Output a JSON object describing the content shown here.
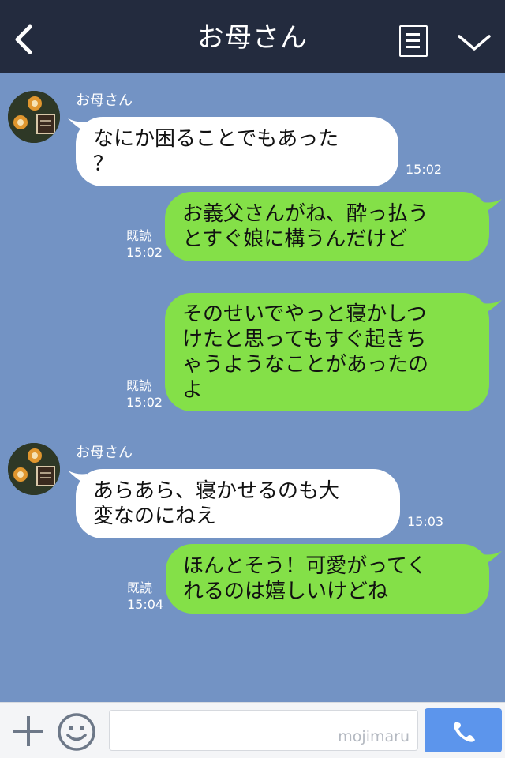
{
  "header": {
    "title": "お母さん",
    "back_icon": "chevron-left-icon",
    "menu_icon": "menu-icon",
    "more_icon": "chevron-down-icon"
  },
  "messages": [
    {
      "direction": "in",
      "sender": "お母さん",
      "text": "なにか困ることでもあった\n？",
      "time": "15:02"
    },
    {
      "direction": "out",
      "read": "既読",
      "text": "お義父さんがね、酔っ払う\nとすぐ娘に構うんだけど",
      "time": "15:02"
    },
    {
      "direction": "out",
      "read": "既読",
      "text": "そのせいでやっと寝かしつ\nけたと思ってもすぐ起きち\nゃうようなことがあったの\nよ",
      "time": "15:02"
    },
    {
      "direction": "in",
      "sender": "お母さん",
      "text": "あらあら、寝かせるのも大\n変なのにねえ",
      "time": "15:03"
    },
    {
      "direction": "out",
      "read": "既読",
      "text": "ほんとそう！可愛がってく\nれるのは嬉しいけどね",
      "time": "15:04"
    }
  ],
  "input_bar": {
    "plus_icon": "plus-icon",
    "emoji_icon": "emoji-icon",
    "watermark": "mojimaru",
    "call_icon": "phone-icon"
  },
  "colors": {
    "header_bg": "#232b3e",
    "chat_bg": "#7393c4",
    "incoming_bubble": "#ffffff",
    "outgoing_bubble": "#84e048",
    "call_button": "#5c95ec"
  }
}
